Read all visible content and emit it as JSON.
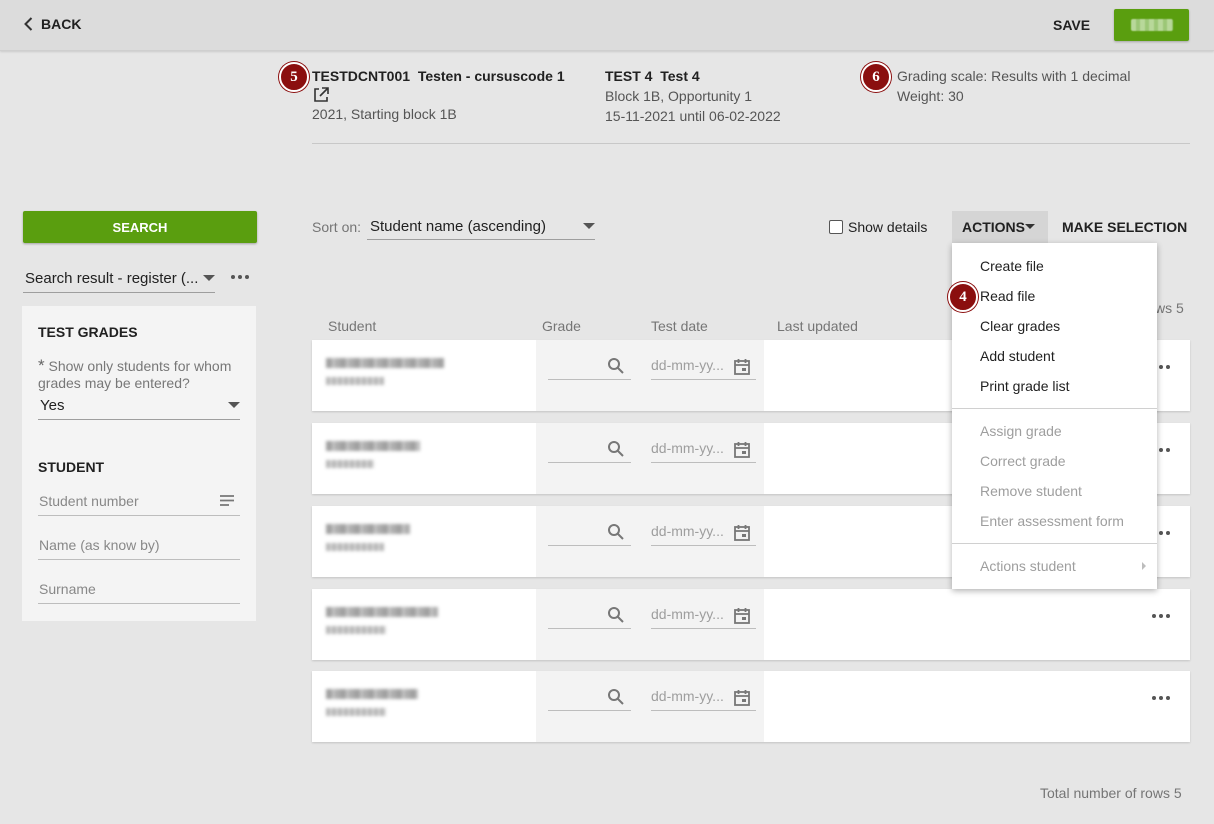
{
  "topbar": {
    "back_label": "BACK",
    "save_label": "SAVE"
  },
  "header": {
    "course_code": "TESTDCNT001",
    "course_name": "Testen - cursuscode 1",
    "course_period": "2021, Starting block 1B",
    "test_code": "TEST 4",
    "test_name": "Test 4",
    "test_block": "Block 1B, Opportunity 1",
    "test_dates": "15-11-2021 until 06-02-2022",
    "grading_scale": "Grading scale: Results with 1 decimal",
    "weight": "Weight: 30"
  },
  "badges": {
    "b5": "5",
    "b6": "6",
    "b4": "4"
  },
  "left": {
    "search_label": "SEARCH",
    "search_result": "Search result - register (...",
    "test_grades_title": "TEST GRADES",
    "show_only_label": "Show only students for whom grades may be entered?",
    "required_mark": "*",
    "show_only_value": "Yes",
    "student_title": "STUDENT",
    "student_number_placeholder": "Student number",
    "name_placeholder": "Name (as know by)",
    "surname_placeholder": "Surname"
  },
  "toolbar": {
    "sort_label": "Sort on:",
    "sort_value": "Student name (ascending)",
    "show_details": "Show details",
    "actions": "ACTIONS",
    "make_selection": "MAKE SELECTION"
  },
  "table": {
    "headers": {
      "student": "Student",
      "grade": "Grade",
      "test_date": "Test date",
      "last_updated": "Last updated"
    },
    "rows_count_fragment": "ws 5",
    "date_placeholder": "dd-mm-yy...",
    "total": "Total number of rows 5"
  },
  "menu": {
    "create_file": "Create file",
    "read_file": "Read file",
    "clear_grades": "Clear grades",
    "add_student": "Add student",
    "print_grade_list": "Print grade list",
    "assign_grade": "Assign grade",
    "correct_grade": "Correct grade",
    "remove_student": "Remove student",
    "enter_assessment_form": "Enter assessment form",
    "actions_student": "Actions student"
  },
  "colors": {
    "accent_green": "#5a9e0f",
    "badge_red": "#8b0f0f"
  }
}
